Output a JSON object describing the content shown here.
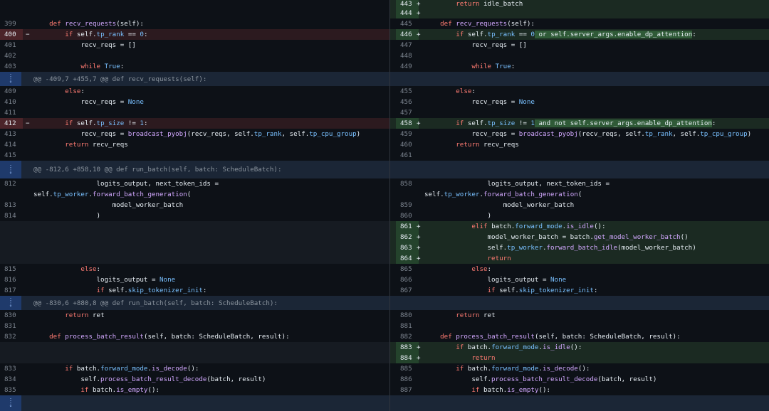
{
  "hunks": [
    {
      "id": "h409",
      "text": "@@ -409,7 +455,7 @@ def recv_requests(self):"
    },
    {
      "id": "h812",
      "text": "@@ -812,6 +858,10 @@ def run_batch(self, batch: ScheduleBatch):"
    },
    {
      "id": "h830",
      "text": "@@ -830,6 +880,8 @@ def run_batch(self, batch: ScheduleBatch):"
    }
  ],
  "rows": [
    {
      "h": 11,
      "right": {
        "n": "443",
        "m": "+",
        "t": "add",
        "code": [
          [
            "        ",
            "pl"
          ],
          [
            "return",
            "kw"
          ],
          [
            " idle_batch",
            "pl"
          ]
        ]
      }
    },
    {
      "h": 15,
      "right": {
        "n": "444",
        "m": "+",
        "t": "add",
        "code": []
      }
    },
    {
      "h": 15,
      "left": {
        "n": "399",
        "code": [
          [
            "    ",
            "pl"
          ],
          [
            "def",
            "kw"
          ],
          [
            " ",
            "pl"
          ],
          [
            "recv_requests",
            "fn"
          ],
          [
            "(self):",
            "pl"
          ]
        ]
      },
      "right": {
        "n": "445",
        "code": [
          [
            "    ",
            "pl"
          ],
          [
            "def",
            "kw"
          ],
          [
            " ",
            "pl"
          ],
          [
            "recv_requests",
            "fn"
          ],
          [
            "(self):",
            "pl"
          ]
        ]
      }
    },
    {
      "h": 15,
      "left": {
        "n": "400",
        "m": "−",
        "t": "del",
        "code": [
          [
            "        ",
            "pl"
          ],
          [
            "if",
            "kw"
          ],
          [
            " self.",
            "pl"
          ],
          [
            "tp_rank",
            "at"
          ],
          [
            " == ",
            "pl"
          ],
          [
            "0",
            "num"
          ],
          [
            ":",
            "pl"
          ]
        ]
      },
      "right": {
        "n": "446",
        "m": "+",
        "t": "add",
        "code": [
          [
            "        ",
            "pl"
          ],
          [
            "if",
            "kw"
          ],
          [
            " self.",
            "pl"
          ],
          [
            "tp_rank",
            "at"
          ],
          [
            " == ",
            "pl"
          ],
          [
            "0",
            "num"
          ],
          [
            " or self.server_args.enable_dp_attention",
            "hl"
          ],
          [
            ":",
            "pl"
          ]
        ]
      }
    },
    {
      "h": 15,
      "left": {
        "n": "401",
        "code": [
          [
            "            recv_reqs = []",
            "pl"
          ]
        ]
      },
      "right": {
        "n": "447",
        "code": [
          [
            "            recv_reqs = []",
            "pl"
          ]
        ]
      }
    },
    {
      "h": 15,
      "left": {
        "n": "402",
        "code": []
      },
      "right": {
        "n": "448",
        "code": []
      }
    },
    {
      "h": 15,
      "left": {
        "n": "403",
        "code": [
          [
            "            ",
            "pl"
          ],
          [
            "while",
            "kw"
          ],
          [
            " ",
            "pl"
          ],
          [
            "True",
            "at"
          ],
          [
            ":",
            "pl"
          ]
        ]
      },
      "right": {
        "n": "449",
        "code": [
          [
            "            ",
            "pl"
          ],
          [
            "while",
            "kw"
          ],
          [
            " ",
            "pl"
          ],
          [
            "True",
            "at"
          ],
          [
            ":",
            "pl"
          ]
        ]
      }
    },
    {
      "h": 20,
      "hunk": 0
    },
    {
      "h": 15,
      "left": {
        "n": "409",
        "code": [
          [
            "        ",
            "pl"
          ],
          [
            "else",
            "kw"
          ],
          [
            ":",
            "pl"
          ]
        ]
      },
      "right": {
        "n": "455",
        "code": [
          [
            "        ",
            "pl"
          ],
          [
            "else",
            "kw"
          ],
          [
            ":",
            "pl"
          ]
        ]
      }
    },
    {
      "h": 15,
      "left": {
        "n": "410",
        "code": [
          [
            "            recv_reqs = ",
            "pl"
          ],
          [
            "None",
            "at"
          ]
        ]
      },
      "right": {
        "n": "456",
        "code": [
          [
            "            recv_reqs = ",
            "pl"
          ],
          [
            "None",
            "at"
          ]
        ]
      }
    },
    {
      "h": 15,
      "left": {
        "n": "411",
        "code": []
      },
      "right": {
        "n": "457",
        "code": []
      }
    },
    {
      "h": 15,
      "left": {
        "n": "412",
        "m": "−",
        "t": "del",
        "code": [
          [
            "        ",
            "pl"
          ],
          [
            "if",
            "kw"
          ],
          [
            " self.",
            "pl"
          ],
          [
            "tp_size",
            "at"
          ],
          [
            " != ",
            "pl"
          ],
          [
            "1",
            "num"
          ],
          [
            ":",
            "pl"
          ]
        ]
      },
      "right": {
        "n": "458",
        "m": "+",
        "t": "add",
        "code": [
          [
            "        ",
            "pl"
          ],
          [
            "if",
            "kw"
          ],
          [
            " self.",
            "pl"
          ],
          [
            "tp_size",
            "at"
          ],
          [
            " != ",
            "pl"
          ],
          [
            "1",
            "num"
          ],
          [
            " and not self.server_args.enable_dp_attention",
            "hl"
          ],
          [
            ":",
            "pl"
          ]
        ]
      }
    },
    {
      "h": 15,
      "left": {
        "n": "413",
        "code": [
          [
            "            recv_reqs = ",
            "pl"
          ],
          [
            "broadcast_pyobj",
            "fn"
          ],
          [
            "(recv_reqs, self.",
            "pl"
          ],
          [
            "tp_rank",
            "at"
          ],
          [
            ", self.",
            "pl"
          ],
          [
            "tp_cpu_group",
            "at"
          ],
          [
            ")",
            "pl"
          ]
        ]
      },
      "right": {
        "n": "459",
        "code": [
          [
            "            recv_reqs = ",
            "pl"
          ],
          [
            "broadcast_pyobj",
            "fn"
          ],
          [
            "(recv_reqs, self.",
            "pl"
          ],
          [
            "tp_rank",
            "at"
          ],
          [
            ", self.",
            "pl"
          ],
          [
            "tp_cpu_group",
            "at"
          ],
          [
            ")",
            "pl"
          ]
        ]
      }
    },
    {
      "h": 15,
      "left": {
        "n": "414",
        "code": [
          [
            "        ",
            "pl"
          ],
          [
            "return",
            "kw"
          ],
          [
            " recv_reqs",
            "pl"
          ]
        ]
      },
      "right": {
        "n": "460",
        "code": [
          [
            "        ",
            "pl"
          ],
          [
            "return",
            "kw"
          ],
          [
            " recv_reqs",
            "pl"
          ]
        ]
      }
    },
    {
      "h": 15,
      "left": {
        "n": "415",
        "code": []
      },
      "right": {
        "n": "461",
        "code": []
      }
    },
    {
      "h": 25,
      "hunk": 1
    },
    {
      "h": 15,
      "left": {
        "n": "812",
        "code": [
          [
            "                logits_output, next_token_ids =",
            "pl"
          ]
        ]
      },
      "right": {
        "n": "858",
        "code": [
          [
            "                logits_output, next_token_ids =",
            "pl"
          ]
        ]
      }
    },
    {
      "h": 15,
      "left": {
        "n": "",
        "code": [
          [
            "self.",
            "pl"
          ],
          [
            "tp_worker",
            "at"
          ],
          [
            ".",
            "pl"
          ],
          [
            "forward_batch_generation",
            "fn"
          ],
          [
            "(",
            "pl"
          ]
        ]
      },
      "right": {
        "n": "",
        "code": [
          [
            "self.",
            "pl"
          ],
          [
            "tp_worker",
            "at"
          ],
          [
            ".",
            "pl"
          ],
          [
            "forward_batch_generation",
            "fn"
          ],
          [
            "(",
            "pl"
          ]
        ]
      }
    },
    {
      "h": 15,
      "left": {
        "n": "813",
        "code": [
          [
            "                    model_worker_batch",
            "pl"
          ]
        ]
      },
      "right": {
        "n": "859",
        "code": [
          [
            "                    model_worker_batch",
            "pl"
          ]
        ]
      }
    },
    {
      "h": 15,
      "left": {
        "n": "814",
        "code": [
          [
            "                )",
            "pl"
          ]
        ]
      },
      "right": {
        "n": "860",
        "code": [
          [
            "                )",
            "pl"
          ]
        ]
      }
    },
    {
      "h": 15,
      "left": {
        "t": "empty"
      },
      "right": {
        "n": "861",
        "m": "+",
        "t": "add",
        "code": [
          [
            "            ",
            "pl"
          ],
          [
            "elif",
            "kw"
          ],
          [
            " batch.",
            "pl"
          ],
          [
            "forward_mode",
            "at"
          ],
          [
            ".",
            "pl"
          ],
          [
            "is_idle",
            "fn"
          ],
          [
            "():",
            "pl"
          ]
        ]
      }
    },
    {
      "h": 15,
      "left": {
        "t": "empty"
      },
      "right": {
        "n": "862",
        "m": "+",
        "t": "add",
        "code": [
          [
            "                model_worker_batch = batch.",
            "pl"
          ],
          [
            "get_model_worker_batch",
            "fn"
          ],
          [
            "()",
            "pl"
          ]
        ]
      }
    },
    {
      "h": 15,
      "left": {
        "t": "empty"
      },
      "right": {
        "n": "863",
        "m": "+",
        "t": "add",
        "code": [
          [
            "                self.",
            "pl"
          ],
          [
            "tp_worker",
            "at"
          ],
          [
            ".",
            "pl"
          ],
          [
            "forward_batch_idle",
            "fn"
          ],
          [
            "(model_worker_batch)",
            "pl"
          ]
        ]
      }
    },
    {
      "h": 15,
      "left": {
        "t": "empty"
      },
      "right": {
        "n": "864",
        "m": "+",
        "t": "add",
        "code": [
          [
            "                ",
            "pl"
          ],
          [
            "return",
            "kw"
          ]
        ]
      }
    },
    {
      "h": 15,
      "left": {
        "n": "815",
        "code": [
          [
            "            ",
            "pl"
          ],
          [
            "else",
            "kw"
          ],
          [
            ":",
            "pl"
          ]
        ]
      },
      "right": {
        "n": "865",
        "code": [
          [
            "            ",
            "pl"
          ],
          [
            "else",
            "kw"
          ],
          [
            ":",
            "pl"
          ]
        ]
      }
    },
    {
      "h": 15,
      "left": {
        "n": "816",
        "code": [
          [
            "                logits_output = ",
            "pl"
          ],
          [
            "None",
            "at"
          ]
        ]
      },
      "right": {
        "n": "866",
        "code": [
          [
            "                logits_output = ",
            "pl"
          ],
          [
            "None",
            "at"
          ]
        ]
      }
    },
    {
      "h": 15,
      "left": {
        "n": "817",
        "code": [
          [
            "                ",
            "pl"
          ],
          [
            "if",
            "kw"
          ],
          [
            " self.",
            "pl"
          ],
          [
            "skip_tokenizer_init",
            "at"
          ],
          [
            ":",
            "pl"
          ]
        ]
      },
      "right": {
        "n": "867",
        "code": [
          [
            "                ",
            "pl"
          ],
          [
            "if",
            "kw"
          ],
          [
            " self.",
            "pl"
          ],
          [
            "skip_tokenizer_init",
            "at"
          ],
          [
            ":",
            "pl"
          ]
        ]
      }
    },
    {
      "h": 20,
      "hunk": 2
    },
    {
      "h": 15,
      "left": {
        "n": "830",
        "code": [
          [
            "        ",
            "pl"
          ],
          [
            "return",
            "kw"
          ],
          [
            " ret",
            "pl"
          ]
        ]
      },
      "right": {
        "n": "880",
        "code": [
          [
            "        ",
            "pl"
          ],
          [
            "return",
            "kw"
          ],
          [
            " ret",
            "pl"
          ]
        ]
      }
    },
    {
      "h": 15,
      "left": {
        "n": "831",
        "code": []
      },
      "right": {
        "n": "881",
        "code": []
      }
    },
    {
      "h": 15,
      "left": {
        "n": "832",
        "code": [
          [
            "    ",
            "pl"
          ],
          [
            "def",
            "kw"
          ],
          [
            " ",
            "pl"
          ],
          [
            "process_batch_result",
            "fn"
          ],
          [
            "(self, batch: ScheduleBatch, result):",
            "pl"
          ]
        ]
      },
      "right": {
        "n": "882",
        "code": [
          [
            "    ",
            "pl"
          ],
          [
            "def",
            "kw"
          ],
          [
            " ",
            "pl"
          ],
          [
            "process_batch_result",
            "fn"
          ],
          [
            "(self, batch: ScheduleBatch, result):",
            "pl"
          ]
        ]
      }
    },
    {
      "h": 15,
      "left": {
        "t": "empty"
      },
      "right": {
        "n": "883",
        "m": "+",
        "t": "add",
        "code": [
          [
            "        ",
            "pl"
          ],
          [
            "if",
            "kw"
          ],
          [
            " batch.",
            "pl"
          ],
          [
            "forward_mode",
            "at"
          ],
          [
            ".",
            "pl"
          ],
          [
            "is_idle",
            "fn"
          ],
          [
            "():",
            "pl"
          ]
        ]
      }
    },
    {
      "h": 15,
      "left": {
        "t": "empty"
      },
      "right": {
        "n": "884",
        "m": "+",
        "t": "add",
        "code": [
          [
            "            ",
            "pl"
          ],
          [
            "return",
            "kw"
          ]
        ]
      }
    },
    {
      "h": 15,
      "left": {
        "n": "833",
        "code": [
          [
            "        ",
            "pl"
          ],
          [
            "if",
            "kw"
          ],
          [
            " batch.",
            "pl"
          ],
          [
            "forward_mode",
            "at"
          ],
          [
            ".",
            "pl"
          ],
          [
            "is_decode",
            "fn"
          ],
          [
            "():",
            "pl"
          ]
        ]
      },
      "right": {
        "n": "885",
        "code": [
          [
            "        ",
            "pl"
          ],
          [
            "if",
            "kw"
          ],
          [
            " batch.",
            "pl"
          ],
          [
            "forward_mode",
            "at"
          ],
          [
            ".",
            "pl"
          ],
          [
            "is_decode",
            "fn"
          ],
          [
            "():",
            "pl"
          ]
        ]
      }
    },
    {
      "h": 15,
      "left": {
        "n": "834",
        "code": [
          [
            "            self.",
            "pl"
          ],
          [
            "process_batch_result_decode",
            "fn"
          ],
          [
            "(batch, result)",
            "pl"
          ]
        ]
      },
      "right": {
        "n": "886",
        "code": [
          [
            "            self.",
            "pl"
          ],
          [
            "process_batch_result_decode",
            "fn"
          ],
          [
            "(batch, result)",
            "pl"
          ]
        ]
      }
    },
    {
      "h": 15,
      "left": {
        "n": "835",
        "code": [
          [
            "            ",
            "pl"
          ],
          [
            "if",
            "kw"
          ],
          [
            " batch.",
            "pl"
          ],
          [
            "is_empty",
            "fn"
          ],
          [
            "():",
            "pl"
          ]
        ]
      },
      "right": {
        "n": "887",
        "code": [
          [
            "            ",
            "pl"
          ],
          [
            "if",
            "kw"
          ],
          [
            " batch.",
            "pl"
          ],
          [
            "is_empty",
            "fn"
          ],
          [
            "():",
            "pl"
          ]
        ]
      }
    },
    {
      "h": 22,
      "hunk": -1
    }
  ],
  "expand_icon": "expand-icon",
  "colors": {
    "bg": "#0d1117",
    "add": "#1b2a22",
    "del": "#2c1a1f",
    "hunk": "#1b2636"
  }
}
